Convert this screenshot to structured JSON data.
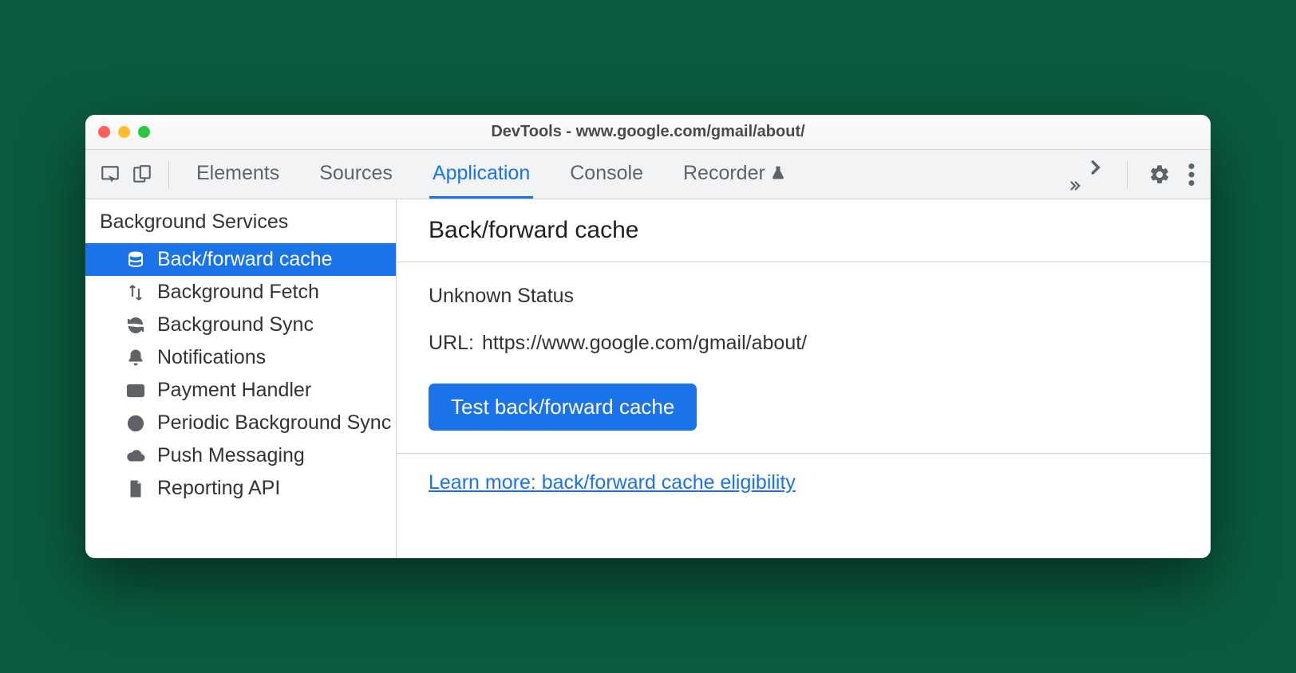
{
  "window": {
    "title": "DevTools - www.google.com/gmail/about/"
  },
  "tabs": {
    "elements": "Elements",
    "sources": "Sources",
    "application": "Application",
    "console": "Console",
    "recorder": "Recorder"
  },
  "sidebar": {
    "section": "Background Services",
    "items": [
      {
        "label": "Back/forward cache",
        "icon": "database-icon",
        "selected": true
      },
      {
        "label": "Background Fetch",
        "icon": "transfer-icon",
        "selected": false
      },
      {
        "label": "Background Sync",
        "icon": "sync-icon",
        "selected": false
      },
      {
        "label": "Notifications",
        "icon": "bell-icon",
        "selected": false
      },
      {
        "label": "Payment Handler",
        "icon": "card-icon",
        "selected": false
      },
      {
        "label": "Periodic Background Sync",
        "icon": "clock-icon",
        "selected": false
      },
      {
        "label": "Push Messaging",
        "icon": "cloud-icon",
        "selected": false
      },
      {
        "label": "Reporting API",
        "icon": "file-icon",
        "selected": false
      }
    ]
  },
  "panel": {
    "title": "Back/forward cache",
    "status": "Unknown Status",
    "url_label": "URL:",
    "url_value": "https://www.google.com/gmail/about/",
    "test_button": "Test back/forward cache",
    "learn_more": "Learn more: back/forward cache eligibility"
  }
}
